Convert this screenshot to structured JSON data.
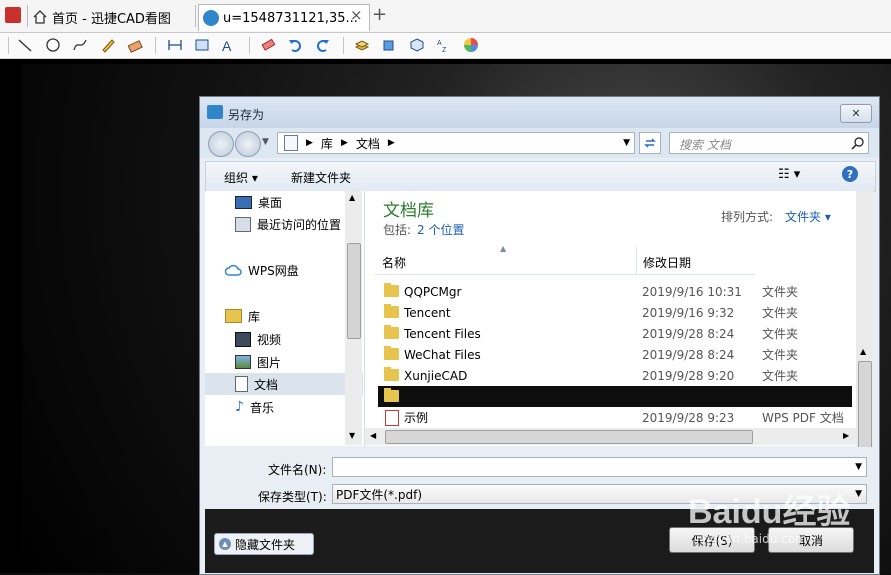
{
  "app": {
    "tabs": [
      {
        "label": "首页 - 迅捷CAD看图"
      },
      {
        "label": "u=1548731121,35..."
      }
    ],
    "new_tab_label": "+",
    "close_tab_label": "×"
  },
  "dialog": {
    "title": "另存为",
    "close_label": "✕",
    "breadcrumb": [
      "库",
      "文档"
    ],
    "search_placeholder": "搜索 文档",
    "organize_label": "组织 ▾",
    "new_folder_label": "新建文件夹",
    "help_label": "?",
    "nav": {
      "favorites": [
        {
          "label": "桌面"
        },
        {
          "label": "最近访问的位置"
        }
      ],
      "cloud": {
        "label": "WPS网盘"
      },
      "library": {
        "label": "库"
      },
      "library_items": [
        {
          "label": "视频"
        },
        {
          "label": "图片"
        },
        {
          "label": "文档"
        },
        {
          "label": "音乐"
        }
      ]
    },
    "library_header": {
      "title": "文档库",
      "includes_label": "包括:",
      "includes_value": "2 个位置",
      "arrange_label": "排列方式:",
      "arrange_value": "文件夹 ▾"
    },
    "columns": {
      "name": "名称",
      "date": "修改日期"
    },
    "files": [
      {
        "name": "QQPCMgr",
        "date": "2019/9/16 10:31",
        "type": "文件夹",
        "kind": "folder"
      },
      {
        "name": "Tencent",
        "date": "2019/9/16 9:32",
        "type": "文件夹",
        "kind": "folder"
      },
      {
        "name": "Tencent Files",
        "date": "2019/9/28 8:24",
        "type": "文件夹",
        "kind": "folder"
      },
      {
        "name": "WeChat Files",
        "date": "2019/9/28 8:24",
        "type": "文件夹",
        "kind": "folder"
      },
      {
        "name": "XunjieCAD",
        "date": "2019/9/28 9:20",
        "type": "文件夹",
        "kind": "folder"
      },
      {
        "name": "示例",
        "date": "2019/9/28 9:23",
        "type": "WPS PDF 文档",
        "kind": "pdf"
      }
    ],
    "filename_label": "文件名(N):",
    "filename_value": "",
    "filetype_label": "保存类型(T):",
    "filetype_value": "PDF文件(*.pdf)",
    "hide_folders_label": "隐藏文件夹",
    "save_label": "保存(S)",
    "cancel_label": "取消"
  },
  "watermark": {
    "text": "Baidu经验",
    "url_text": "jingyan.baidu.com"
  },
  "colors": {
    "accent": "#2d7d2d",
    "link": "#1a5fb4",
    "folder": "#e7c44e"
  }
}
